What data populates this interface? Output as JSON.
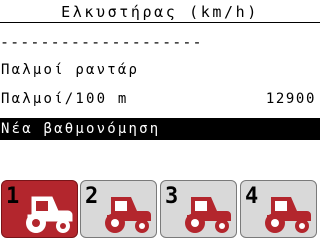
{
  "header": {
    "title": "Ελκυστήρας (km/h)"
  },
  "separator": "--------------------",
  "rows": [
    {
      "label": "Παλμοί ραντάρ",
      "value": ""
    },
    {
      "label": "Παλμοί/100 m",
      "value": "12900"
    },
    {
      "label": "Νέα βαθμονόμηση",
      "value": ""
    }
  ],
  "tabs": [
    {
      "number": "1",
      "icon": "tractor-icon",
      "active": true
    },
    {
      "number": "2",
      "icon": "tractor-icon",
      "active": false
    },
    {
      "number": "3",
      "icon": "tractor-icon",
      "active": false
    },
    {
      "number": "4",
      "icon": "tractor-icon",
      "active": false
    }
  ],
  "colors": {
    "active_tab": "#b3262d",
    "inactive_tab": "#d9d9d9",
    "tractor_red": "#b3262d",
    "highlight_bar": "#000000"
  }
}
